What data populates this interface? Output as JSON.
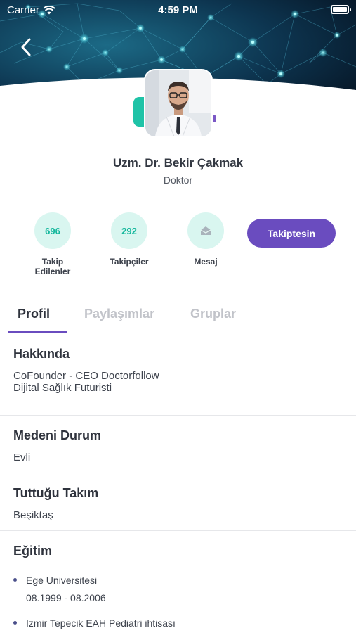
{
  "status_bar": {
    "carrier": "Carrier",
    "time": "4:59 PM"
  },
  "profile": {
    "name": "Uzm. Dr. Bekir Çakmak",
    "title": "Doktor"
  },
  "stats": [
    {
      "value": "696",
      "label": "Takip Edilenler"
    },
    {
      "value": "292",
      "label": "Takipçiler"
    },
    {
      "value": "",
      "label": "Mesaj",
      "icon": "mail-icon"
    }
  ],
  "follow_button": {
    "label": "Takiptesin"
  },
  "tabs": [
    {
      "label": "Profil",
      "active": true
    },
    {
      "label": "Paylaşımlar",
      "active": false
    },
    {
      "label": "Gruplar",
      "active": false
    }
  ],
  "sections": {
    "about": {
      "title": "Hakkında",
      "lines": [
        "CoFounder - CEO Doctorfollow",
        "Dijital Sağlık Futuristi"
      ]
    },
    "marital": {
      "title": "Medeni Durum",
      "value": "Evli"
    },
    "team": {
      "title": "Tuttuğu Takım",
      "value": "Beşiktaş"
    },
    "education": {
      "title": "Eğitim",
      "items": [
        {
          "name": "Ege Universitesi",
          "dates": "08.1999 - 08.2006"
        },
        {
          "name": "Izmir Tepecik EAH Pediatri ihtisası",
          "dates": ""
        }
      ]
    }
  },
  "colors": {
    "accent_purple": "#6a4cbf",
    "accent_green": "#14b79c",
    "header_dark": "#0b2a3d"
  }
}
